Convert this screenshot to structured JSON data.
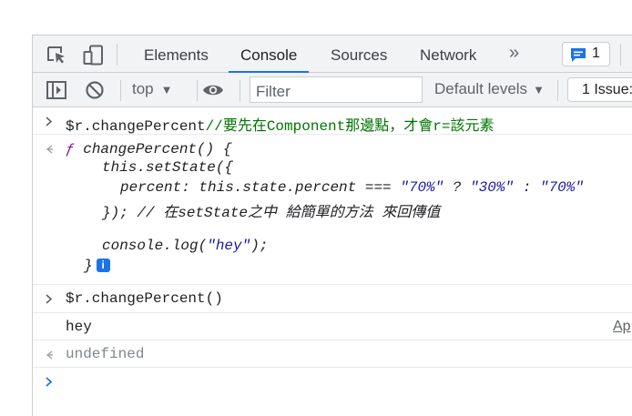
{
  "tabs": [
    {
      "label": "Elements",
      "active": false
    },
    {
      "label": "Console",
      "active": true
    },
    {
      "label": "Sources",
      "active": false
    },
    {
      "label": "Network",
      "active": false
    }
  ],
  "more_tabs": "»",
  "issues_badge_count": "1",
  "toolbar": {
    "context": "top",
    "context_arrow": "▼",
    "filter_placeholder": "Filter",
    "levels_label": "Default levels",
    "levels_arrow": "▼",
    "issues_label": "1 Issue:"
  },
  "console": {
    "cmd1_code": "$r.changePercent",
    "cmd1_comment": "//要先在Component那邊點，才會r=該元素",
    "result1": {
      "line1_f": "ƒ",
      "line1_sig": " changePercent() {",
      "line2": "this.setState({",
      "line3_prop": "percent: this.state.percent === ",
      "line3_s1": "\"70%\"",
      "line3_q": " ? ",
      "line3_s2": "\"30%\"",
      "line3_c": " : ",
      "line3_s3": "\"70%\"",
      "line4": "}); // 在setState之中 給簡單的方法 來回傳值",
      "line5_code": "console.log(",
      "line5_str": "\"hey\"",
      "line5_end": ");",
      "line6": "}",
      "info_glyph": "i"
    },
    "cmd2": "$r.changePercent()",
    "log_output": "hey",
    "log_source": "Ap",
    "return_value": "undefined"
  },
  "colors": {
    "accent": "#1a73e8",
    "comment": "#007400",
    "string": "#1a1aa6",
    "muted": "#80868b"
  },
  "icons": [
    "inspect-element-icon",
    "device-toolbar-icon",
    "sidebar-toggle-icon",
    "clear-console-icon",
    "eye-icon",
    "issues-icon",
    "prompt-chevron-icon",
    "return-arrow-icon"
  ]
}
